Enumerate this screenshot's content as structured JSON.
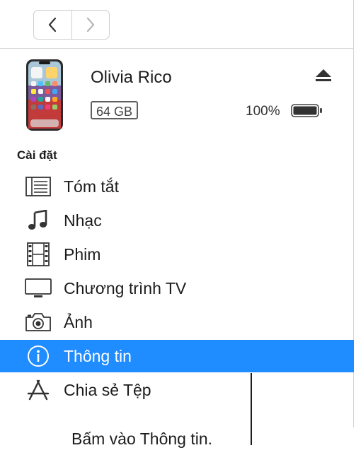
{
  "device": {
    "name": "Olivia Rico",
    "capacity": "64 GB",
    "battery_percent": "100%",
    "battery_level": 1.0
  },
  "sidebar": {
    "section_title": "Cài đặt",
    "items": [
      {
        "label": "Tóm tắt",
        "icon": "summary-list-icon",
        "selected": false
      },
      {
        "label": "Nhạc",
        "icon": "music-note-icon",
        "selected": false
      },
      {
        "label": "Phim",
        "icon": "film-strip-icon",
        "selected": false
      },
      {
        "label": "Chương trình TV",
        "icon": "tv-icon",
        "selected": false
      },
      {
        "label": "Ảnh",
        "icon": "camera-icon",
        "selected": false
      },
      {
        "label": "Thông tin",
        "icon": "info-icon",
        "selected": true
      },
      {
        "label": "Chia sẻ Tệp",
        "icon": "app-store-icon",
        "selected": false
      }
    ]
  },
  "colors": {
    "selection": "#1f8cff",
    "text": "#1c1c1e",
    "divider": "#d6d6d6"
  },
  "callout": {
    "text": "Bấm vào Thông tin."
  }
}
